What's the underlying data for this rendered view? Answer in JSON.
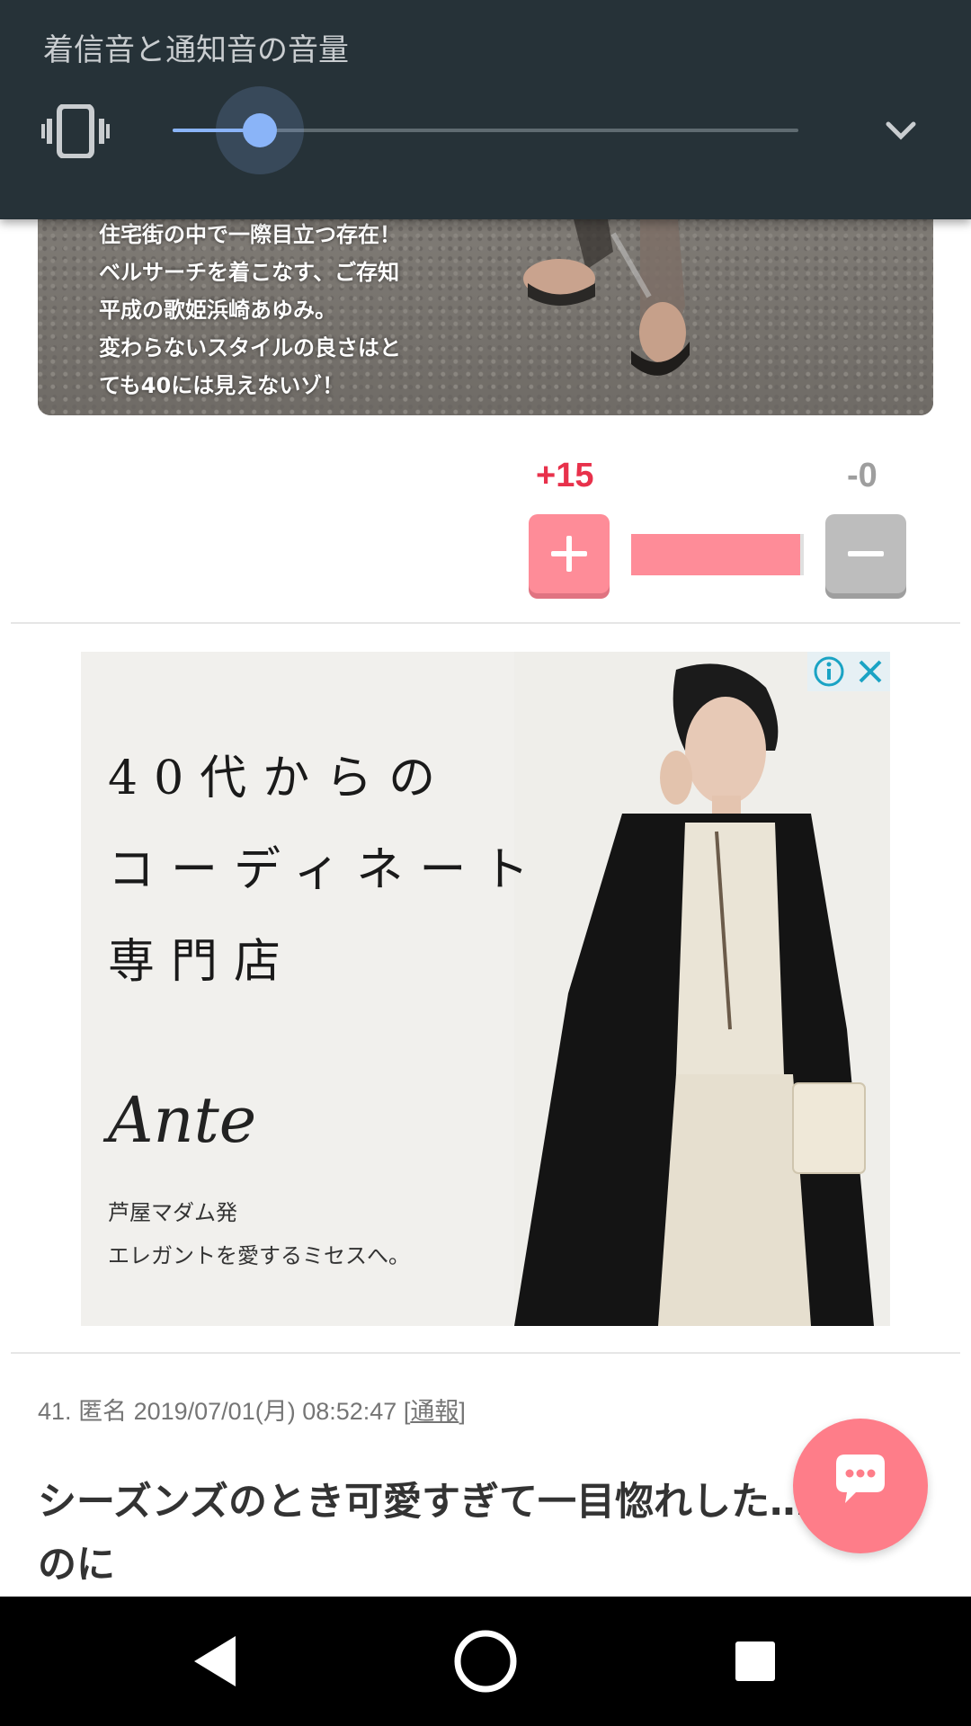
{
  "volume_panel": {
    "title": "着信音と通知音の音量",
    "level_percent": 14,
    "icons": {
      "mode": "vibrate-icon",
      "expand": "chevron-down-icon"
    },
    "accent_color": "#8ab4f8"
  },
  "article_image": {
    "caption_lines": [
      "住宅街の中で一際目立つ存在！",
      "ベルサーチを着こなす、ご存知",
      "平成の歌姫浜崎あゆみ。",
      "変わらないスタイルの良さはと",
      "ても40には見えないゾ！"
    ]
  },
  "votes": {
    "plus": "+15",
    "minus": "-0",
    "plus_ratio": 0.98,
    "plus_color": "#fe8c98",
    "minus_color": "#bdbdbd"
  },
  "ad": {
    "headline_lines": [
      "40代からの",
      "コーディネート",
      "専門店"
    ],
    "brand": "Ante",
    "tagline_lines": [
      "芦屋マダム発",
      "エレガントを愛するミセスへ。"
    ],
    "icons": {
      "info": "info-icon",
      "close": "close-icon"
    }
  },
  "comment": {
    "number": "41.",
    "author": "匿名",
    "timestamp": "2019/07/01(月) 08:52:47",
    "report_open": "[",
    "report_label": "通報",
    "report_close": "]",
    "body": "シーズンズのとき可愛すぎて一目惚れした…だったのに"
  },
  "fab": {
    "icon": "chat-bubble-icon",
    "color": "#fe7d89"
  },
  "nav_bar": {
    "back": "back-icon",
    "home": "home-icon",
    "recents": "recents-icon"
  }
}
